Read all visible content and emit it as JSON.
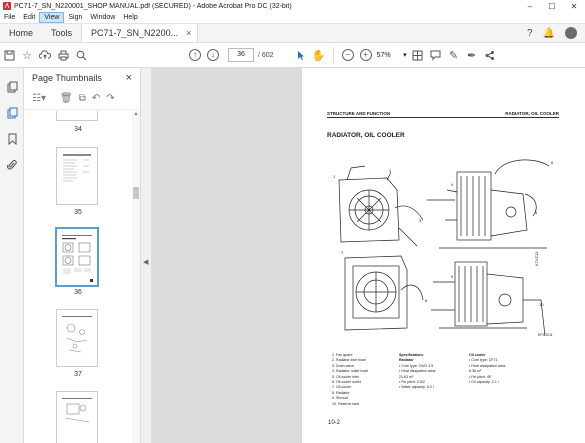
{
  "window": {
    "title": "PC71-7_SN_N220001_SHOP MANUAL.pdf (SECURED) - Adobe Acrobat Pro DC (32-bit)",
    "controls": [
      "–",
      "☐",
      "✕"
    ]
  },
  "menu": {
    "items": [
      {
        "label": "File",
        "active": false
      },
      {
        "label": "Edit",
        "active": false
      },
      {
        "label": "View",
        "active": true
      },
      {
        "label": "Sign",
        "active": false
      },
      {
        "label": "Window",
        "active": false
      },
      {
        "label": "Help",
        "active": false
      }
    ]
  },
  "tabs": {
    "home": "Home",
    "tools": "Tools",
    "document": "PC71-7_SN_N2200...",
    "close": "×"
  },
  "toolbar": {
    "current_page": "36",
    "total_pages": "/ 602",
    "zoom": "57%"
  },
  "thumbnails": {
    "title": "Page Thumbnails",
    "close": "×",
    "items": [
      {
        "label": "34",
        "selected": false
      },
      {
        "label": "35",
        "selected": false
      },
      {
        "label": "36",
        "selected": true
      },
      {
        "label": "37",
        "selected": false
      },
      {
        "label": "",
        "selected": false
      }
    ]
  },
  "page": {
    "header_left": "STRUCTURE AND FUNCTION",
    "header_right": "RADIATOR, OIL COOLER",
    "title": "RADIATOR, OIL COOLER",
    "figure_code": "EPC7011",
    "side_code": "K7VZ13",
    "legend_items": [
      "1. Fan guard",
      "2. Radiator inlet hose",
      "3. Drain valve",
      "4. Radiator outlet hose",
      "5. Oil cooler inlet",
      "6. Oil cooler outlet",
      "7. Oil cooler",
      "8. Radiator",
      "9. Shroud",
      "10. Reserve tank"
    ],
    "spec_title": "Specifications",
    "radiator": {
      "heading": "Radiator",
      "lines": [
        "• Core type: CWX 3.5",
        "• Heat dissipation area:",
        "   21.63 m²",
        "• Fin pitch: 3.5/2",
        "• Water capacity: 8.2 l"
      ]
    },
    "oil_cooler": {
      "heading": "Oil cooler",
      "lines": [
        "• Core type: CF71",
        "• Heat dissipation area:",
        "   6.38 m²",
        "• Fin pitch: 4P",
        "• Oil capacity: 2.1 l"
      ]
    },
    "page_number": "10-2"
  }
}
